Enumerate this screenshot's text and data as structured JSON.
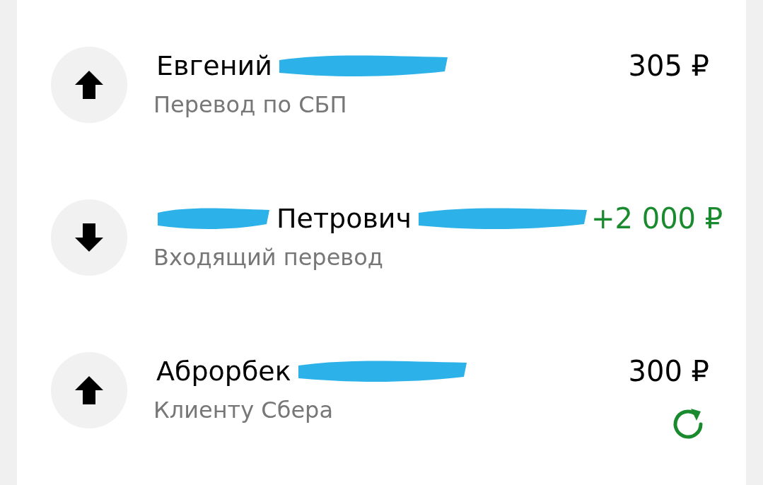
{
  "operations": [
    {
      "kind": "outgoing",
      "name": "Евгений",
      "redacted_before": false,
      "redacted_after": true,
      "description": "Перевод по СБП",
      "amount": "305 ₽",
      "repeatable": false
    },
    {
      "kind": "incoming",
      "name": "Петрович",
      "redacted_before": true,
      "redacted_after": true,
      "description": "Входящий перевод",
      "amount": "+2 000 ₽",
      "repeatable": false
    },
    {
      "kind": "outgoing",
      "name": "Аброрбек",
      "redacted_before": false,
      "redacted_after": true,
      "description": "Клиенту Сбера",
      "amount": "300 ₽",
      "repeatable": true
    }
  ]
}
